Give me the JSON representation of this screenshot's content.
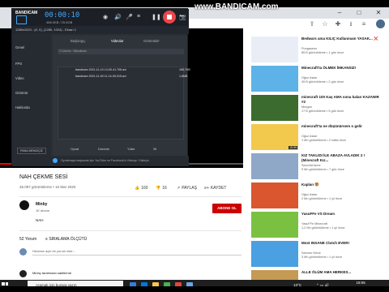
{
  "bandicam_watermark": "www.BANDICAM.com",
  "bandicam": {
    "logo": "BANDICAM",
    "rec_time": "00:00:10",
    "rec_size": "468.0KB / 25.6GB",
    "sub_title": "1280x1024 - (0, 0), (1280, 1024) - Ekran 1",
    "sidebar": [
      "Genel",
      "FPS",
      "Video",
      "Görüntü",
      "Hakkında"
    ],
    "mini_button": "PANA MENÜ/ÇİZ",
    "tabs": [
      "Başlangıç",
      "Videolar",
      "Görüntüler"
    ],
    "path": "C:\\Users\\...\\Bandicam",
    "files": [
      {
        "name": "bandicam 2021-11-10 14-00-41-706.avi",
        "size": "165,7KB"
      },
      {
        "name": "bandicam 2021-11-00 11-14-00-015.avi",
        "size": "1,8MB"
      }
    ],
    "bottom_buttons": [
      "Oynat",
      "Düzenle",
      "Yükle",
      "Sil"
    ],
    "footer": "Oynatmaya başlamak için YouTube ve Facebook'a Videoyu Yükleyin"
  },
  "browser": {
    "win_controls": [
      "–",
      "□",
      "✕"
    ]
  },
  "video": {
    "title": "NAH ÇEKME SESİ",
    "meta": "26.097 görüntüleme • 10 Mar 2020",
    "likes": "160",
    "dislikes": "16",
    "share": "PAYLAŞ",
    "save": "KAYDET",
    "progress": 0.45
  },
  "channel": {
    "name": "Minby",
    "subs": "1K abone",
    "subscribe": "ABONE OL",
    "description": "NAH"
  },
  "comments": {
    "count": "52 Yorum",
    "sort": "SIRALAMA ÖLÇÜTÜ",
    "placeholder": "Herkese açık bir yorum ekle...",
    "first": "Minby tarafından sabitlendi"
  },
  "recommendations": [
    {
      "title": "Bedwars ama KILIÇ Kullanmam YASAK... ❌",
      "channel": "Pungaseus",
      "views": "85 B görüntüleme • 1 gün önce",
      "duration": "",
      "color": "#e9eef6"
    },
    {
      "title": "Minecraft'ta ÖLMEK İMKANSIZ!",
      "channel": "Oğuz Aslan",
      "views": "45 B görüntüleme • 2 gün önce",
      "duration": "",
      "color": "#5db3e8"
    },
    {
      "title": "minecraft 100 Kaş AMA sona kalan KAZANIR #2",
      "channel": "Morgan",
      "views": "17 B görüntüleme • 5 gün önce",
      "duration": "",
      "color": "#3b6b2f"
    },
    {
      "title": "minecraft'ta ne düşünürsem o gelir",
      "channel": "Oğuz Aslan",
      "views": "1 Mn görüntüleme • 2 hafta önce",
      "duration": "15:59",
      "color": "#f2c94c"
    },
    {
      "title": "KIZ TAKLIDI İLE ABAZA AVLADIK 2 ! (Minecraft Kız...",
      "channel": "Sezontd Anne",
      "views": "9 Mn görüntüleme • 7 gün önce",
      "duration": "",
      "color": "#8fa8c8"
    },
    {
      "title": "Kaplan 🐯",
      "channel": "Oğuz Aslan",
      "views": "2 Mn görüntüleme • 1 yıl önce",
      "duration": "",
      "color": "#d9562e"
    },
    {
      "title": "YasuFFe VS Dream",
      "channel": "YasuFFe Minecraft",
      "views": "1,2 Mn görüntüleme • 1 yıl önce",
      "duration": "",
      "color": "#7ac142"
    },
    {
      "title": "Most INSANE Clutch EVER!",
      "channel": "Samuro Nöral",
      "views": "3 Mn görüntüleme • 1 yıl önce",
      "duration": "",
      "color": "#4aa0e0"
    },
    {
      "title": "ALLE ÖLÜM AMA HERKES...",
      "channel": "",
      "views": "",
      "duration": "",
      "color": "#c49a54"
    }
  ],
  "taskbar": {
    "search": "Aramak için buraya yazın",
    "temperature": "13°C",
    "time": "19:05",
    "date": "10.11.2021"
  }
}
